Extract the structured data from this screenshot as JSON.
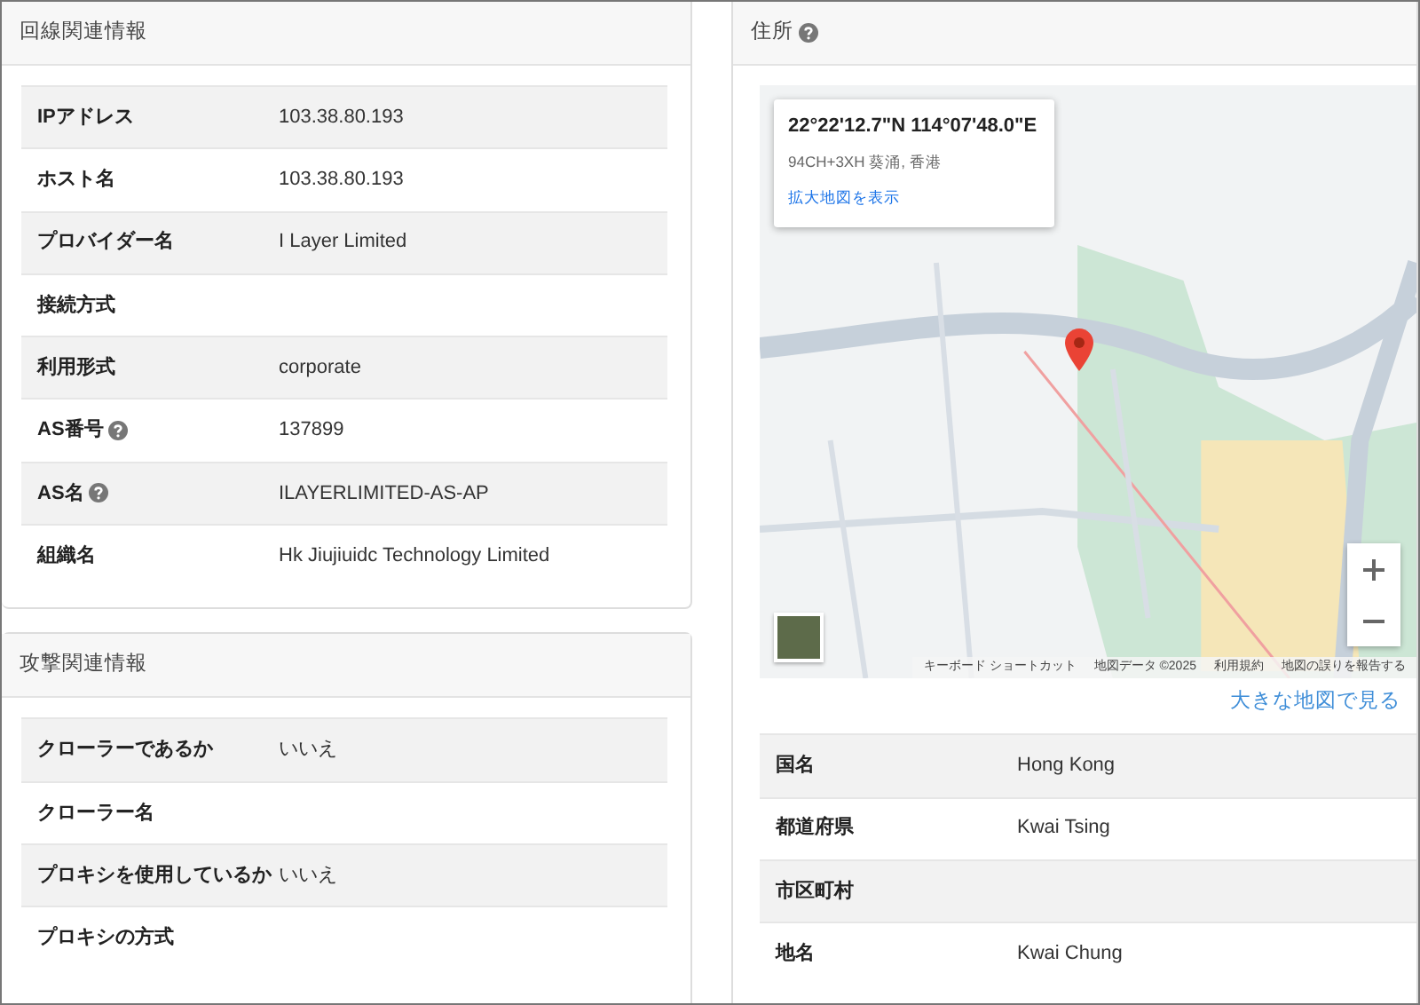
{
  "line_info": {
    "title": "回線関連情報",
    "rows": [
      {
        "label": "IPアドレス",
        "value": "103.38.80.193",
        "help": false
      },
      {
        "label": "ホスト名",
        "value": "103.38.80.193",
        "help": false
      },
      {
        "label": "プロバイダー名",
        "value": "I Layer Limited",
        "help": false
      },
      {
        "label": "接続方式",
        "help": false
      },
      {
        "label": "利用形式",
        "value": "corporate",
        "help": false
      },
      {
        "label": "AS番号",
        "value": "137899",
        "help": true
      },
      {
        "label": "AS名",
        "value": "ILAYERLIMITED-AS-AP",
        "help": true
      },
      {
        "label": "組織名",
        "value": "Hk Jiujiuidc Technology Limited",
        "help": false
      }
    ]
  },
  "attack_info": {
    "title": "攻撃関連情報",
    "rows": [
      {
        "label": "クローラーであるか",
        "value": "いいえ",
        "help": false
      },
      {
        "label": "クローラー名",
        "help": false
      },
      {
        "label": "プロキシを使用しているか",
        "value": "いいえ",
        "help": false
      },
      {
        "label": "プロキシの方式",
        "help": false
      }
    ]
  },
  "address": {
    "title": "住所",
    "help": true,
    "map": {
      "coordinates": "22°22'12.7\"N 114°07'48.0\"E",
      "plus_code": "94CH+3XH 葵涌, 香港",
      "open_link": "拡大地図を表示",
      "footer": [
        "キーボード ショートカット",
        "地図データ ©2025",
        "利用規約",
        "地図の誤りを報告する"
      ]
    },
    "large_map_link": "大きな地図で見る",
    "rows": [
      {
        "label": "国名",
        "value": "Hong Kong",
        "help": false
      },
      {
        "label": "都道府県",
        "value": "Kwai Tsing",
        "help": false
      },
      {
        "label": "市区町村",
        "help": false
      },
      {
        "label": "地名",
        "value": "Kwai Chung",
        "help": false
      }
    ]
  }
}
